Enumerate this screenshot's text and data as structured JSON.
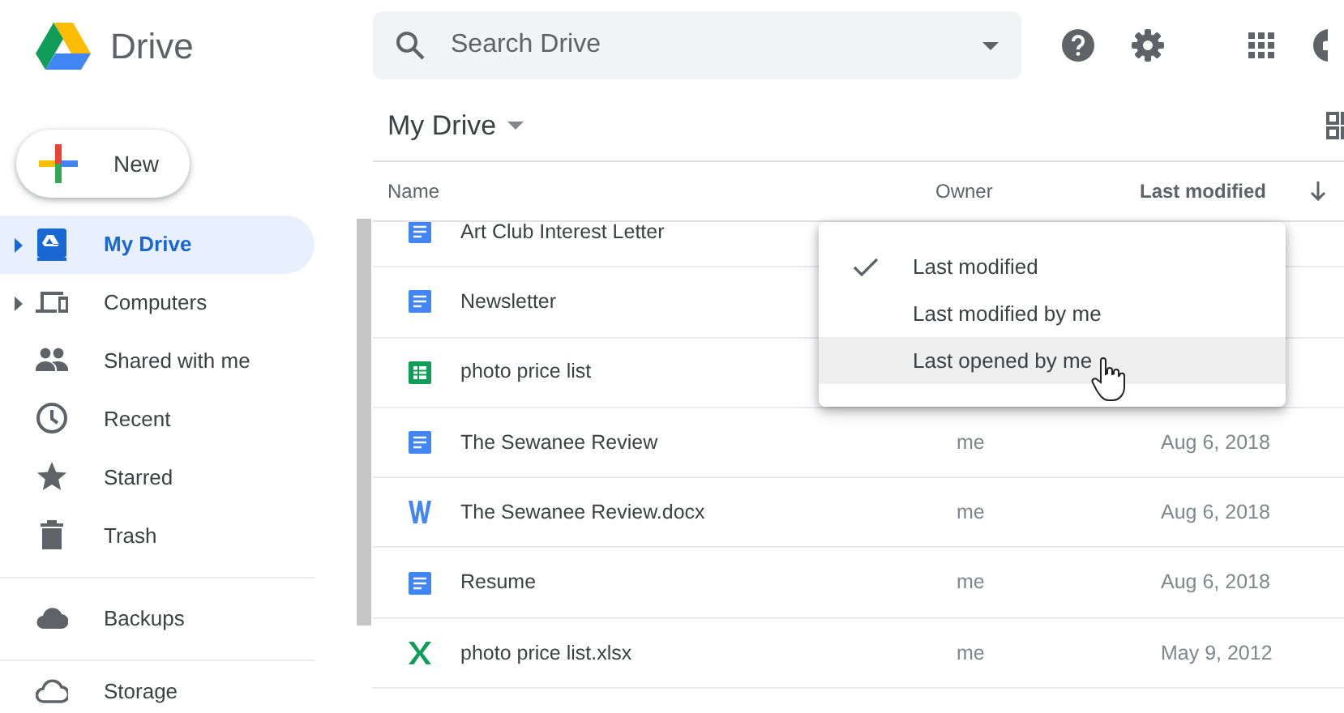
{
  "app": {
    "name": "Drive"
  },
  "search": {
    "placeholder": "Search Drive"
  },
  "new_button": {
    "label": "New"
  },
  "sidebar": {
    "items": [
      {
        "label": "My Drive",
        "kind": "drive",
        "expandable": true,
        "selected": true
      },
      {
        "label": "Computers",
        "kind": "computers",
        "expandable": true,
        "selected": false
      },
      {
        "label": "Shared with me",
        "kind": "people",
        "expandable": false,
        "selected": false
      },
      {
        "label": "Recent",
        "kind": "clock",
        "expandable": false,
        "selected": false
      },
      {
        "label": "Starred",
        "kind": "star",
        "expandable": false,
        "selected": false
      },
      {
        "label": "Trash",
        "kind": "trash",
        "expandable": false,
        "selected": false
      },
      {
        "label": "Backups",
        "kind": "cloud",
        "expandable": false,
        "selected": false,
        "divider_before": true
      },
      {
        "label": "Storage",
        "kind": "cloud-outline",
        "expandable": false,
        "selected": false,
        "divider_before": true
      }
    ]
  },
  "breadcrumb": {
    "title": "My Drive"
  },
  "table": {
    "columns": [
      "Name",
      "Owner",
      "Last modified"
    ],
    "rows": [
      {
        "name": "Art Club Interest Letter",
        "kind": "doc"
      },
      {
        "name": "Newsletter",
        "kind": "doc"
      },
      {
        "name": "photo price list",
        "kind": "sheet"
      },
      {
        "name": "The Sewanee Review",
        "kind": "doc",
        "owner": "me",
        "modified": "Aug 6, 2018"
      },
      {
        "name": "The Sewanee Review.docx",
        "kind": "word",
        "owner": "me",
        "modified": "Aug 6, 2018"
      },
      {
        "name": "Resume",
        "kind": "doc",
        "owner": "me",
        "modified": "Aug 6, 2018"
      },
      {
        "name": "photo price list.xlsx",
        "kind": "excel",
        "owner": "me",
        "modified": "May 9, 2012"
      }
    ]
  },
  "sort_menu": {
    "items": [
      {
        "label": "Last modified",
        "checked": true,
        "highlighted": false
      },
      {
        "label": "Last modified by me",
        "checked": false,
        "highlighted": false
      },
      {
        "label": "Last opened by me",
        "checked": false,
        "highlighted": true
      }
    ]
  }
}
